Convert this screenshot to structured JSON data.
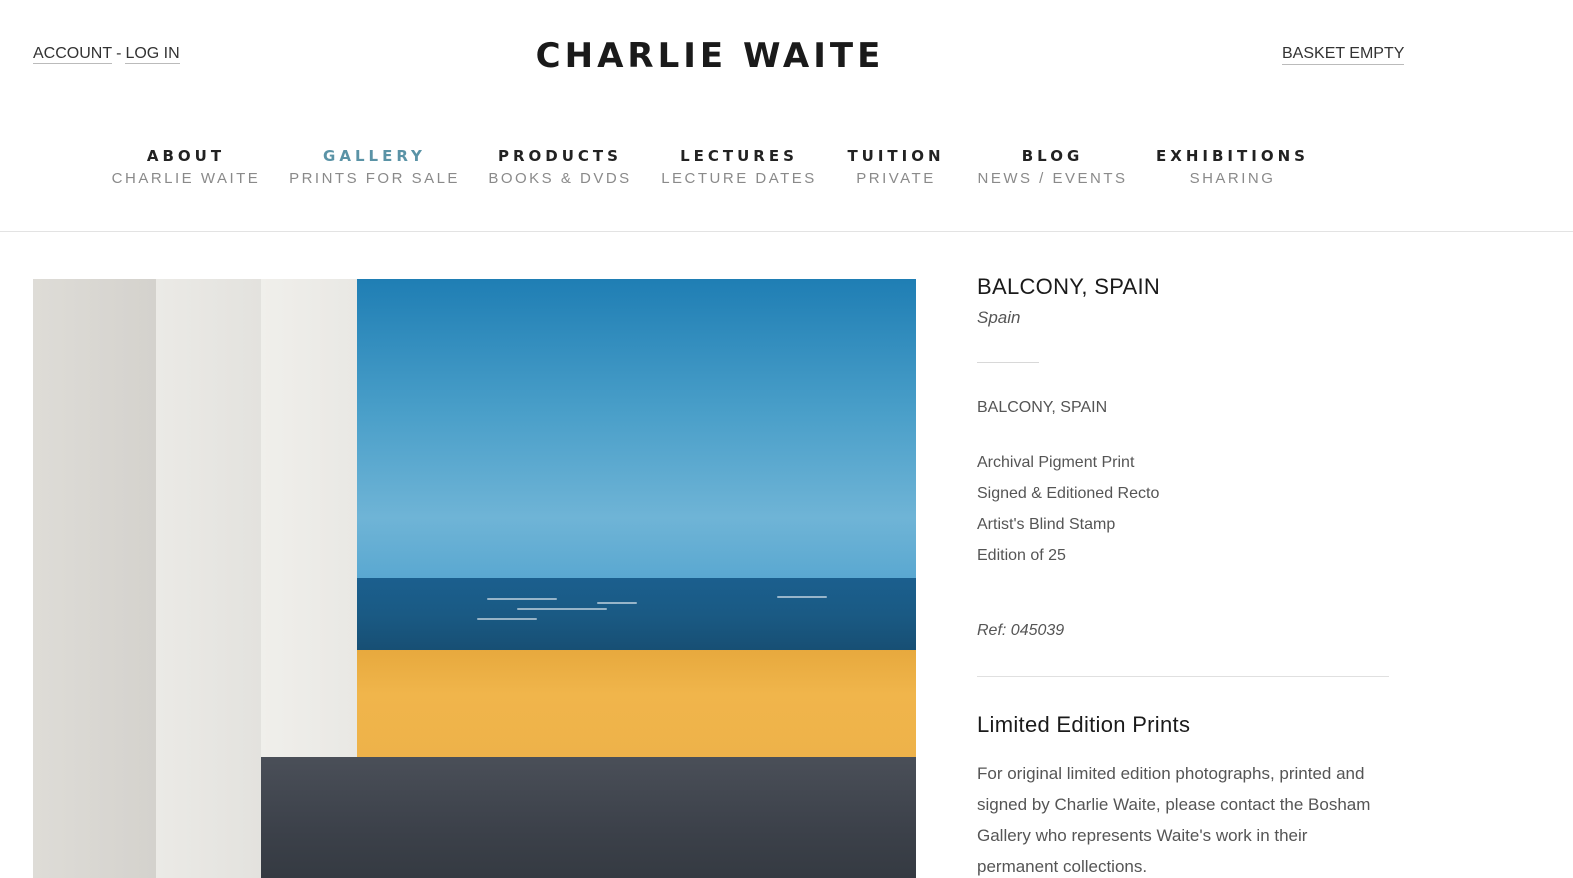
{
  "header": {
    "account_label": "ACCOUNT",
    "separator": "-",
    "login_label": "LOG IN",
    "logo": "CHARLIE WAITE",
    "basket_label": "BASKET EMPTY"
  },
  "nav": {
    "items": [
      {
        "title": "ABOUT",
        "sub": "CHARLIE WAITE"
      },
      {
        "title": "GALLERY",
        "sub": "PRINTS FOR SALE"
      },
      {
        "title": "PRODUCTS",
        "sub": "BOOKS & DVDS"
      },
      {
        "title": "LECTURES",
        "sub": "LECTURE DATES"
      },
      {
        "title": "TUITION",
        "sub": "PRIVATE"
      },
      {
        "title": "BLOG",
        "sub": "NEWS / EVENTS"
      },
      {
        "title": "EXHIBITIONS",
        "sub": "SHARING"
      }
    ],
    "active_index": 1,
    "accent_color": "#5a93a6"
  },
  "product": {
    "title": "BALCONY, SPAIN",
    "location": "Spain",
    "name_repeat": "BALCONY, SPAIN",
    "specs": [
      "Archival Pigment Print",
      "Signed & Editioned Recto",
      "Artist's Blind Stamp",
      "Edition of 25"
    ],
    "ref": "Ref: 045039"
  },
  "limited": {
    "title": "Limited Edition Prints",
    "body": "For original limited edition photographs, printed and signed by Charlie Waite, please contact the Bosham Gallery who represents Waite's work in their permanent collections."
  }
}
